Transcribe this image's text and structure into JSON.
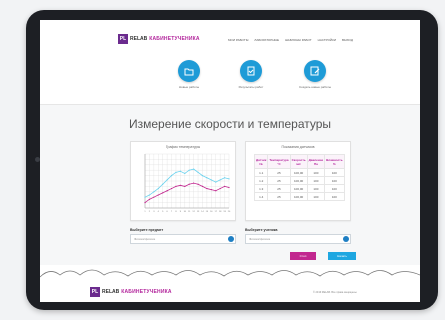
{
  "header": {
    "logo_mark": "PL",
    "logo_text": "RELAB",
    "logo_sub": "КАБИНЕТУЧЕНИКА",
    "nav": [
      "Мои работы",
      "Лабораторные",
      "Шаблоны работ",
      "Настройки",
      "Выход"
    ]
  },
  "icons": [
    {
      "name": "Новые работы",
      "icon": "folder-open-icon"
    },
    {
      "name": "Результаты работ",
      "icon": "document-check-icon"
    },
    {
      "name": "Создать новые работы",
      "icon": "edit-icon"
    }
  ],
  "main": {
    "title": "Измерение скорости и температуры",
    "chart_title": "График температуры",
    "table_title": "Показания датчиков",
    "table": {
      "headers": [
        "Датчик №",
        "Температура °С",
        "Скорость м/с",
        "Давление Па",
        "Влажность %"
      ],
      "rows": [
        [
          "1.1",
          "25",
          "100,00",
          "100",
          "100"
        ],
        [
          "1.2",
          "25",
          "100,00",
          "100",
          "100"
        ],
        [
          "1.3",
          "25",
          "100,00",
          "100",
          "100"
        ],
        [
          "1.4",
          "25",
          "100,00",
          "100",
          "100"
        ]
      ]
    },
    "select_left_label": "Выберите предмет",
    "select_left_placeholder": "Физика/физика",
    "select_right_label": "Выберите ученика",
    "select_right_placeholder": "Физика/физика",
    "stop_label": "Стоп",
    "start_label": "Начать"
  },
  "footer": {
    "logo_mark": "PL",
    "logo_text": "RELAB",
    "logo_sub": "КАБИНЕТУЧЕНИКА",
    "copyright": "© 2016 RELAB. Все права защищены."
  },
  "colors": {
    "accent": "#1e9bd7",
    "brand": "#b2249b",
    "series1": "#6ad2ee",
    "series2": "#c2278f"
  },
  "chart_data": {
    "type": "line",
    "title": "График температуры",
    "x": [
      1,
      2,
      3,
      4,
      5,
      6,
      7,
      8,
      9,
      10,
      11,
      12,
      13,
      14,
      15,
      16,
      17,
      18,
      19,
      20
    ],
    "series": [
      {
        "values": [
          10,
          12,
          15,
          18,
          22,
          26,
          30,
          33,
          34,
          32,
          35,
          36,
          33,
          30,
          28,
          26,
          24,
          26,
          28,
          27
        ]
      },
      {
        "values": [
          5,
          8,
          10,
          12,
          14,
          16,
          18,
          20,
          21,
          20,
          22,
          23,
          22,
          20,
          18,
          17,
          16,
          18,
          20,
          19
        ]
      }
    ],
    "ylim": [
      0,
      50
    ],
    "grid": true
  }
}
